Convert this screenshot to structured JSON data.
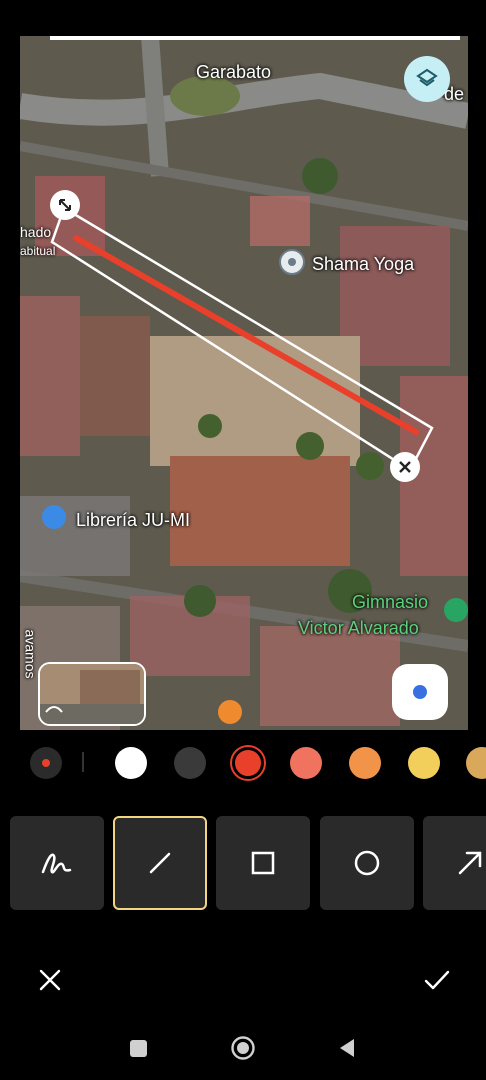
{
  "map": {
    "labels": {
      "garabato": "Garabato",
      "de": "de",
      "shama_yoga": "Shama Yoga",
      "hado": "hado",
      "abitual": "abitual",
      "libreria": "Librería JU-MI",
      "gimnasio_line1": "Gimnasio",
      "gimnasio_line2": "Victor Alvarado",
      "avamos": "avamos"
    },
    "icons": {
      "layers": "layers-icon",
      "location": "my-location-icon",
      "resize": "resize-handle-icon",
      "delete": "delete-shape-icon"
    },
    "drawn_line_color": "#e8402a"
  },
  "colors": {
    "current": "#e8402a",
    "swatches": [
      "#ffffff",
      "#3a3a3a",
      "#e8402a",
      "#f07360",
      "#f2934a",
      "#f2cf5a",
      "#d9a85a"
    ],
    "selected_index": 2
  },
  "tools": [
    {
      "name": "pen",
      "icon": "pen-scribble-icon"
    },
    {
      "name": "line",
      "icon": "line-icon",
      "selected": true
    },
    {
      "name": "rectangle",
      "icon": "rectangle-icon"
    },
    {
      "name": "circle",
      "icon": "circle-icon"
    },
    {
      "name": "arrow",
      "icon": "arrow-icon"
    }
  ],
  "actions": {
    "cancel": "close-icon",
    "confirm": "check-icon"
  },
  "nav": {
    "recents": "recents-icon",
    "home": "home-icon",
    "back": "back-icon"
  }
}
